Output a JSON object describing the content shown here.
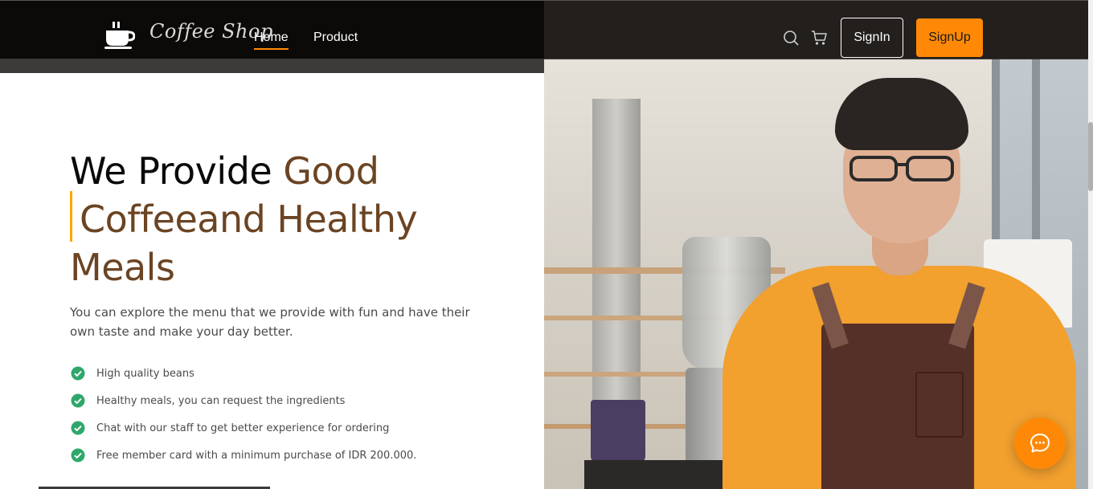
{
  "nav": {
    "brand": "Coffee Shop",
    "links": [
      {
        "label": "Home",
        "active": true
      },
      {
        "label": "Product",
        "active": false
      }
    ],
    "icons": [
      "search-icon",
      "cart-icon"
    ],
    "signin_label": "SignIn",
    "signup_label": "SignUp"
  },
  "hero": {
    "headline_part1": "We Provide ",
    "headline_part2": "Good",
    "headline_part3": "Coffeeand Healthy",
    "headline_part4": "Meals",
    "description": "You can explore the menu that we provide with fun and have their own taste and make your day better.",
    "features": [
      "High quality beans",
      "Healthy meals, you can request the ingredients",
      "Chat with our staff to get better experience for ordering",
      "Free member card with a minimum purchase of IDR 200.000."
    ],
    "image": "barista-photo"
  },
  "chat": {
    "icon": "chat-bubble-icon"
  },
  "colors": {
    "accent": "#ff8906",
    "brown": "#6b4423",
    "navbar": "#0c0a09",
    "check": "#2fa76b"
  }
}
